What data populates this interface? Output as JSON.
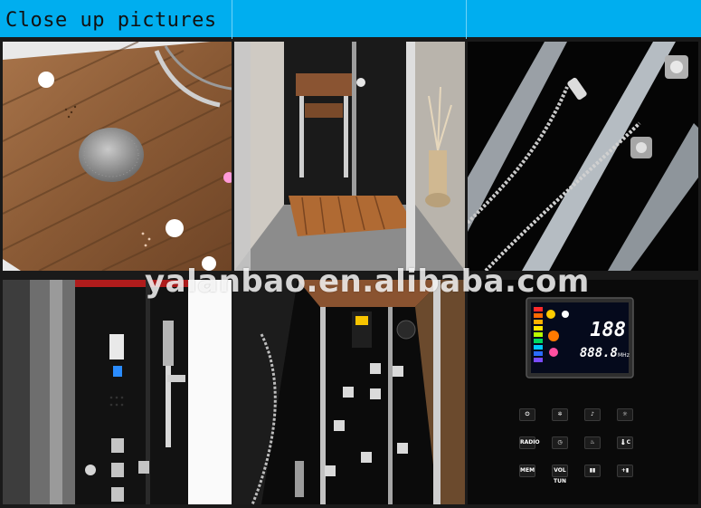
{
  "header": {
    "title": "Close up pictures"
  },
  "watermark": "yalanbao.en.alibaba.com",
  "photos": [
    {
      "name": "wooden-ceiling-with-rain-shower-head"
    },
    {
      "name": "shower-cabin-with-wooden-stool-and-floor"
    },
    {
      "name": "hand-shower-hose-and-massage-jets"
    },
    {
      "name": "black-shower-panel-side-view"
    },
    {
      "name": "interior-black-panel-with-body-jets"
    },
    {
      "name": "lcd-control-panel-close-up"
    }
  ],
  "control_panel": {
    "display_main": "188",
    "display_freq": "888.8",
    "freq_unit": "MHz",
    "buttons": [
      "⏻",
      "✲",
      "♪",
      "☼",
      "RADIO",
      "◷",
      "♨",
      "🌡C",
      "MEM",
      "VOL TUN",
      "▮▮",
      "+▮"
    ]
  }
}
